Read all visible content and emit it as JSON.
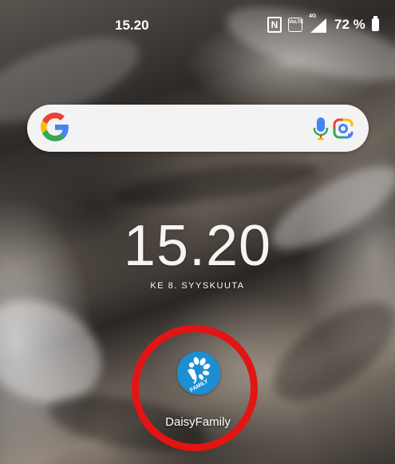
{
  "status_bar": {
    "time": "15.20",
    "nfc_symbol": "N",
    "volte_label": "VoLTE",
    "network_label": "4G",
    "battery": "72 %",
    "icons": [
      "nfc-icon",
      "volte-icon",
      "signal-icon",
      "battery-icon"
    ]
  },
  "search_bar": {
    "icons": [
      "google-g-icon",
      "mic-icon",
      "google-lens-icon"
    ]
  },
  "clock": {
    "time": "15.20",
    "date": "KE 8. SYYSKUUTA"
  },
  "app": {
    "label": "DaisyFamily",
    "icon_badge_text": "FAMILY",
    "icon_name": "daisyfamily-app-icon",
    "icon_color": "#1b8fd4"
  },
  "annotation": {
    "circle_color": "#e31414"
  },
  "colors": {
    "google_blue": "#4285f4",
    "google_red": "#ea4335",
    "google_yellow": "#fbbc05",
    "google_green": "#34a853"
  }
}
